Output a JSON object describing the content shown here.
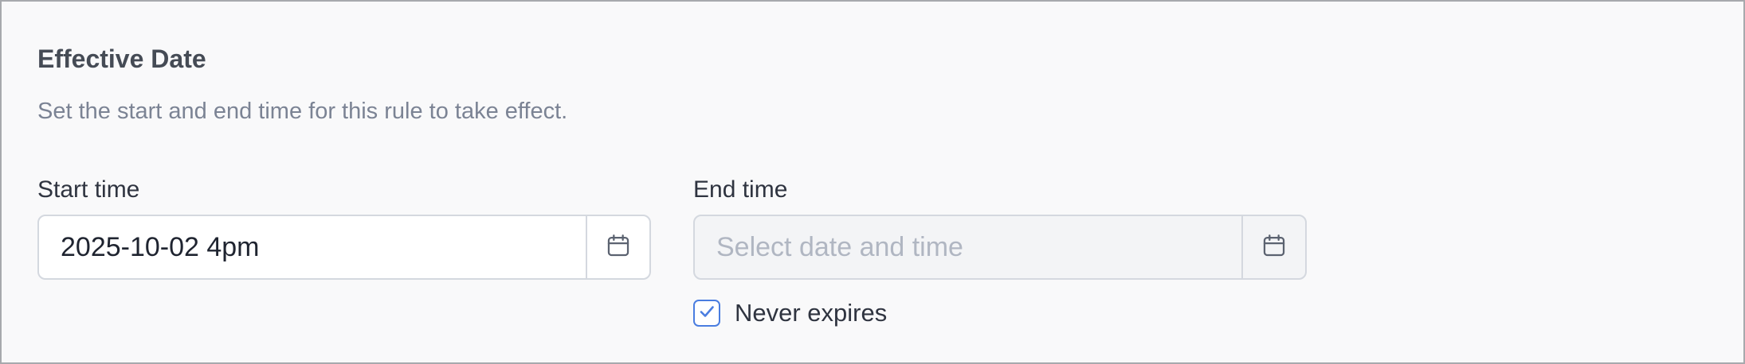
{
  "section": {
    "title": "Effective Date",
    "description": "Set the start and end time for this rule to take effect."
  },
  "start_time": {
    "label": "Start time",
    "value": "2025-10-02 4pm",
    "placeholder": ""
  },
  "end_time": {
    "label": "End time",
    "value": "",
    "placeholder": "Select date and time"
  },
  "never_expires": {
    "label": "Never expires",
    "checked": true
  },
  "icons": {
    "calendar": "calendar-icon",
    "check": "check-icon"
  },
  "colors": {
    "accent": "#4a7de0",
    "panel_background": "#f9f9fa",
    "disabled_input_background": "#f3f4f6"
  }
}
